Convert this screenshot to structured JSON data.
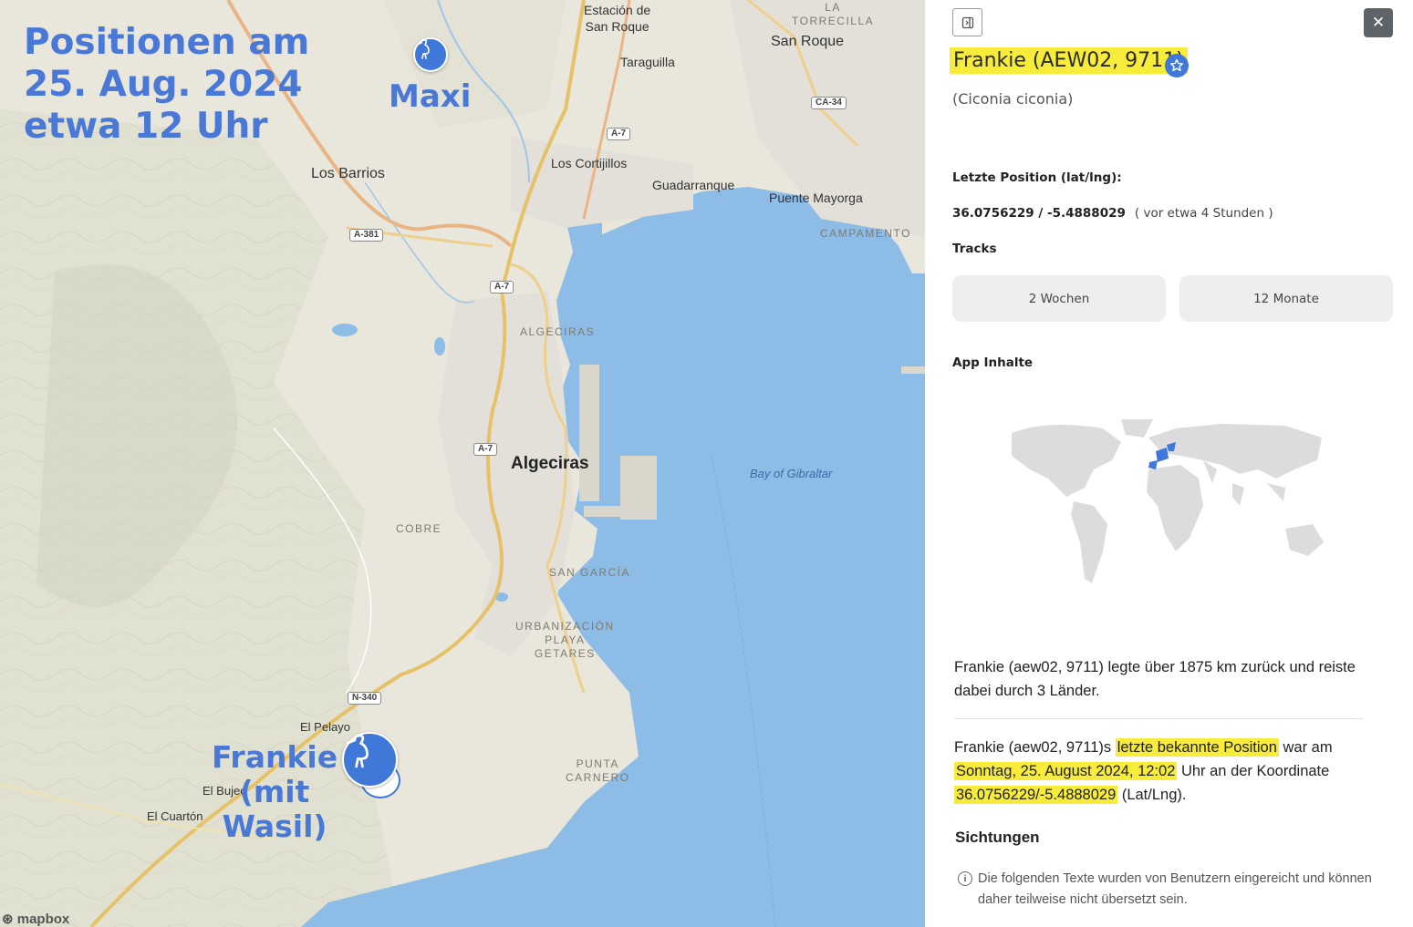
{
  "map": {
    "overlay": {
      "heading_lines": [
        "Positionen am",
        "25. Aug. 2024",
        "etwa 12 Uhr"
      ],
      "maxi": "Maxi",
      "frankie_lines": [
        "Frankie",
        "(mit",
        "Wasil)"
      ]
    },
    "places": {
      "estacion": [
        "Estación de",
        "San Roque"
      ],
      "torrecilla": [
        "LA",
        "TORRECILLA"
      ],
      "san_roque": "San Roque",
      "taraguilla": "Taraguilla",
      "los_barrios": "Los Barrios",
      "los_cortijillos": "Los Cortijillos",
      "guadarranque": "Guadarranque",
      "puente_mayorga": "Puente Mayorga",
      "campamento": "CAMPAMENTO",
      "algeciras_district": "ALGECIRAS",
      "algeciras": "Algeciras",
      "bay": "Bay of Gibraltar",
      "cobre": "COBRE",
      "san_garcia": "SAN GARCÍA",
      "urbanizacion": [
        "URBANIZACIÓN",
        "PLAYA",
        "GETARES"
      ],
      "punta_carnero": [
        "PUNTA",
        "CARNERO"
      ],
      "el_pelayo": "El Pelayo",
      "el_bujeo": "El Bujeo",
      "el_cuarton": "El Cuartón"
    },
    "shields": {
      "a381": "A-381",
      "a7_north": "A-7",
      "a7_mid": "A-7",
      "a7_south": "A-7",
      "ca34": "CA-34",
      "n340": "N-340"
    },
    "attribution": "mapbox"
  },
  "panel": {
    "title": "Frankie (AEW02, 9711)",
    "species": "(Ciconia ciconia)",
    "last_position_label": "Letzte Position (lat/lng):",
    "lat_lng": "36.0756229 / -5.4888029",
    "ago": "( vor etwa 4 Stunden )",
    "tracks_label": "Tracks",
    "track_2w": "2 Wochen",
    "track_12m": "12 Monate",
    "app_label": "App Inhalte",
    "summary": "Frankie (aew02, 9711) legte über 1875 km zurück und reiste dabei durch 3 Länder.",
    "last_known": {
      "prefix": "Frankie (aew02, 9711)s ",
      "hl1": "letzte bekannte Position",
      "mid1": " war am ",
      "hl2": "Sonntag, 25. August 2024, 12:02",
      "mid2": " Uhr an der Koordinate ",
      "hl3": "36.0756229/-5.4888029",
      "suffix": " (Lat/Lng)."
    },
    "sightings_label": "Sichtungen",
    "sightings_info": "Die folgenden Texte wurden von Benutzern eingereicht und können daher teilweise nicht übersetzt sein."
  },
  "colors": {
    "accent": "#3f78d8",
    "highlight": "#f7ec3a",
    "water": "#8dbde6",
    "land": "#e9e6dc"
  }
}
